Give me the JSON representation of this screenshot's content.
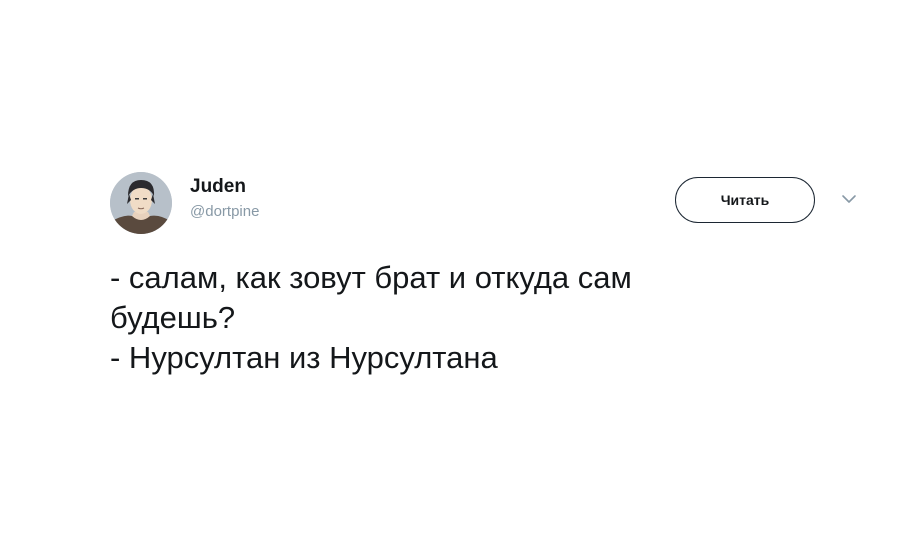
{
  "author": {
    "display_name": "Juden",
    "handle": "@dortpine",
    "avatar_icon": "avatar-portrait"
  },
  "actions": {
    "follow_label": "Читать",
    "menu_icon": "chevron-down-icon"
  },
  "tweet": {
    "lines": [
      "- салам, как зовут брат и откуда сам",
      "будешь?",
      "- Нурсултан из Нурсултана"
    ]
  },
  "colors": {
    "text": "#14171a",
    "secondary": "#8899a6",
    "button_border": "#1c2733",
    "background": "#ffffff"
  }
}
